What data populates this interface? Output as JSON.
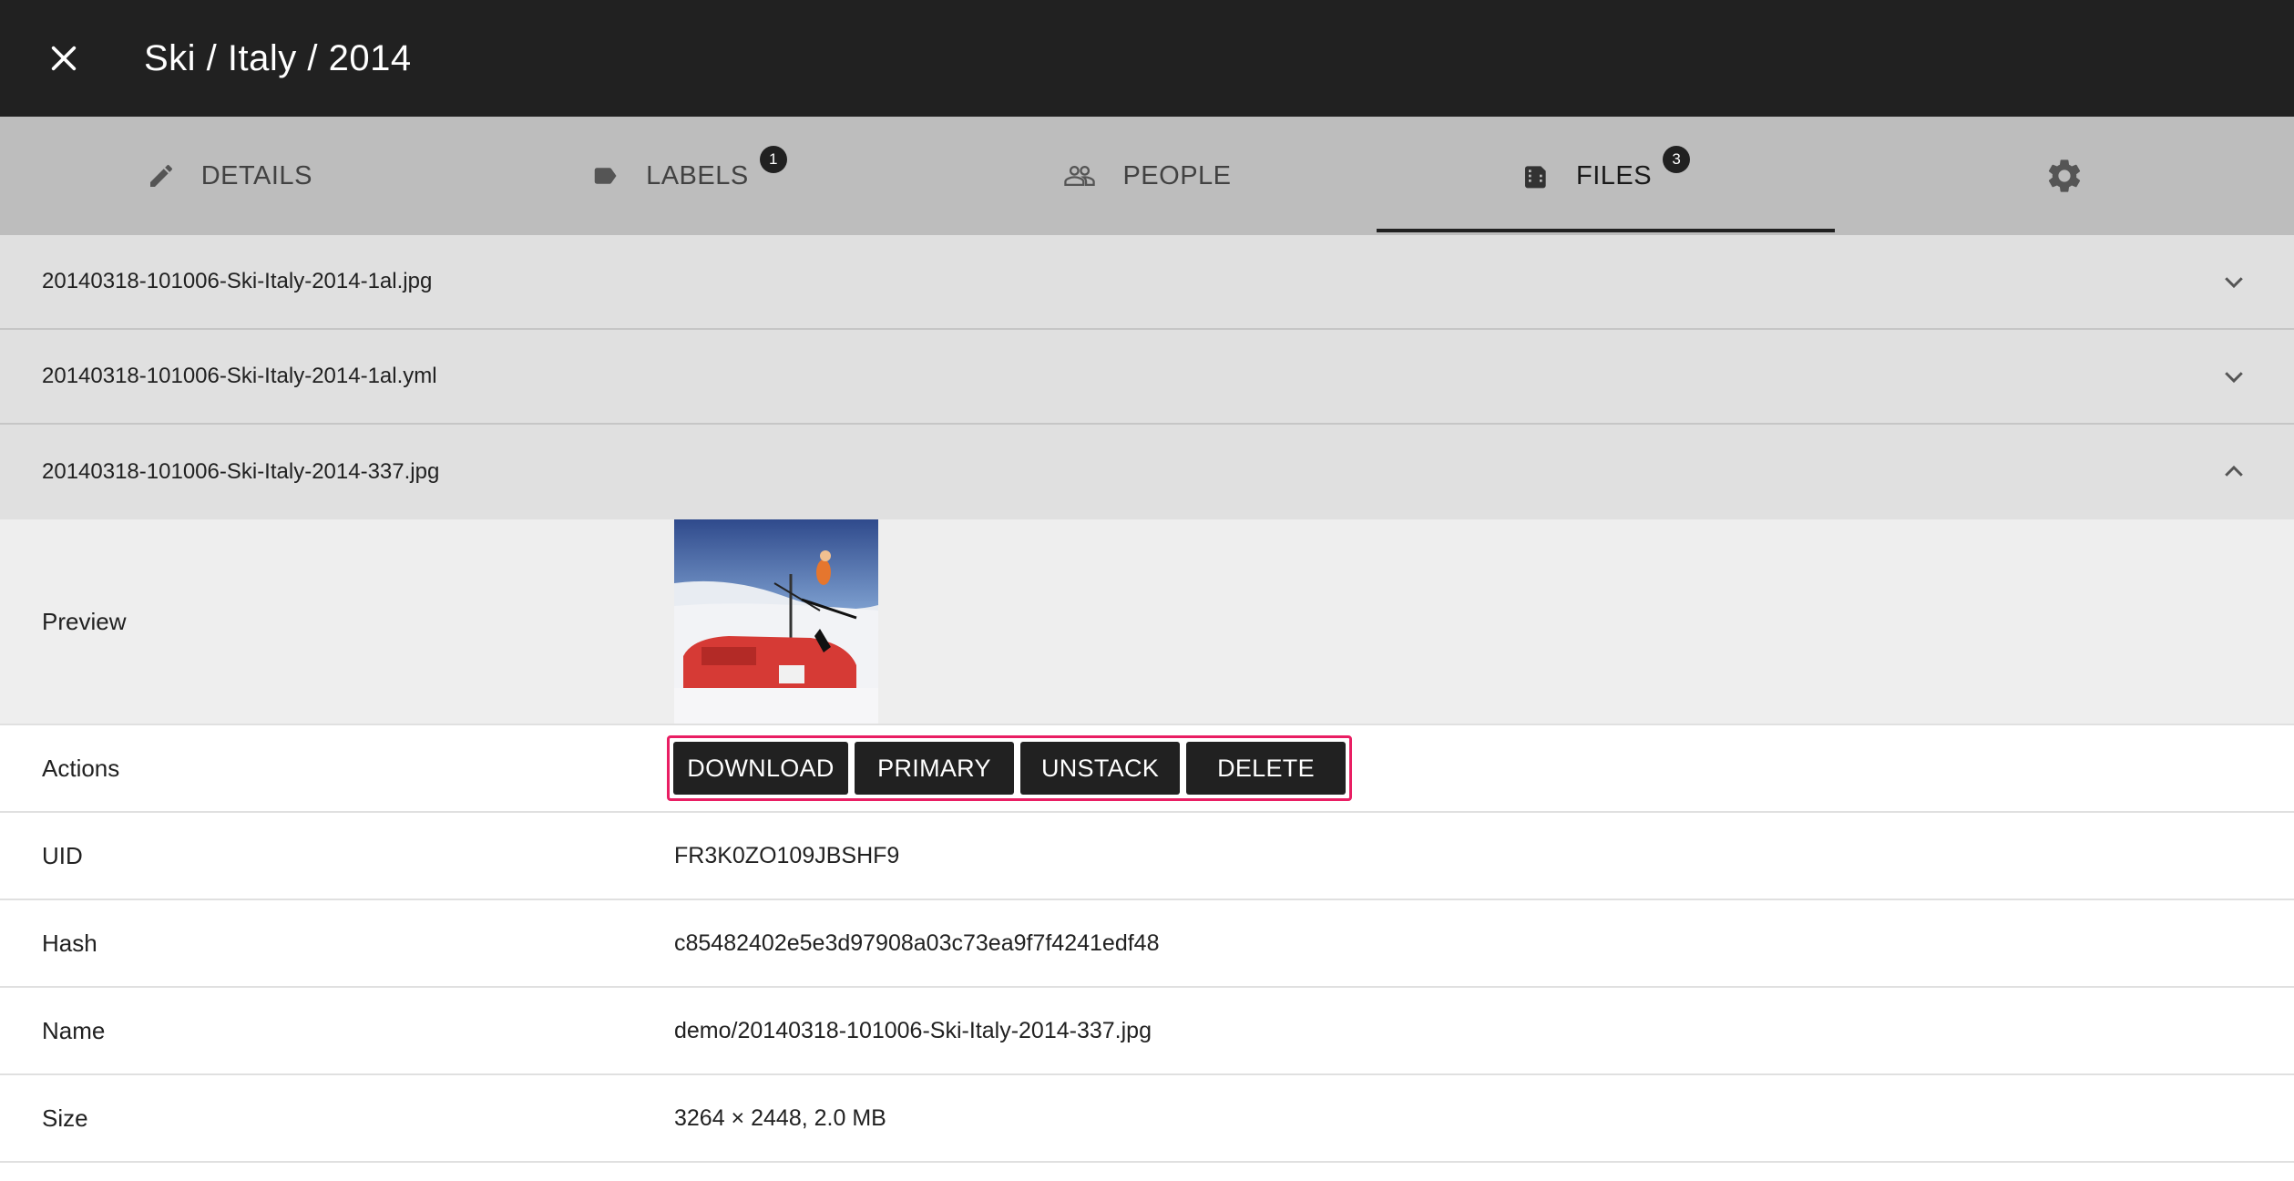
{
  "toolbar": {
    "title": "Ski / Italy / 2014",
    "close_icon": "close-icon"
  },
  "tabs": [
    {
      "label": "Details",
      "icon": "pencil-icon"
    },
    {
      "label": "Labels",
      "icon": "label-icon",
      "badge": "1"
    },
    {
      "label": "People",
      "icon": "people-icon"
    },
    {
      "label": "Files",
      "icon": "files-icon",
      "badge": "3",
      "active": true
    },
    {
      "label": "",
      "icon": "gear-icon"
    }
  ],
  "files": [
    {
      "name": "20140318-101006-Ski-Italy-2014-1al.jpg",
      "expanded": false
    },
    {
      "name": "20140318-101006-Ski-Italy-2014-1al.yml",
      "expanded": false
    },
    {
      "name": "20140318-101006-Ski-Italy-2014-337.jpg",
      "expanded": true
    }
  ],
  "details": {
    "preview_label": "Preview",
    "actions_label": "Actions",
    "actions": {
      "download": "DOWNLOAD",
      "primary": "PRIMARY",
      "unstack": "UNSTACK",
      "delete": "DELETE"
    },
    "uid_label": "UID",
    "uid": "FR3K0ZO109JBSHF9",
    "hash_label": "Hash",
    "hash": "c85482402e5e3d97908a03c73ea9f7f4241edf48",
    "name_label": "Name",
    "name": "demo/20140318-101006-Ski-Italy-2014-337.jpg",
    "size_label": "Size",
    "size": "3264 × 2448, 2.0 MB"
  },
  "colors": {
    "toolbar": "#212121",
    "tabs": "#bdbdbd",
    "panel": "#e0e0e0",
    "highlight": "#e91e63"
  }
}
